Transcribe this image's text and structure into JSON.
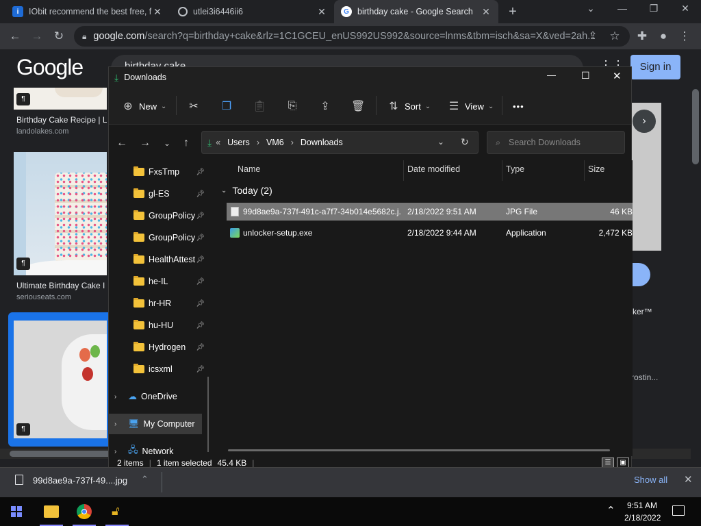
{
  "browser": {
    "tabs": [
      {
        "title": "IObit recommend the best free, f",
        "favicon_color": "#1e6bd6",
        "active": false
      },
      {
        "title": "utlei3i6446ii6",
        "favicon_color": "#5f6368",
        "active": false
      },
      {
        "title": "birthday cake - Google Search",
        "favicon_color": "#4285f4",
        "active": true
      }
    ],
    "new_tab": "+",
    "omnibox": {
      "host": "google.com",
      "path": "/search?q=birthday+cake&rlz=1C1GCEU_enUS992US992&source=lnms&tbm=isch&sa=X&ved=2ah..."
    }
  },
  "google": {
    "logo": "Google",
    "search_value": "birthday cake",
    "signin": "Sign in",
    "results": [
      {
        "caption": "Birthday Cake Recipe | L",
        "source": "landolakes.com"
      },
      {
        "caption": "Ultimate Birthday Cake I",
        "source": "seriouseats.com"
      },
      {
        "caption": "ker™",
        "source": ""
      },
      {
        "caption": "rostin...",
        "source": ""
      }
    ]
  },
  "explorer": {
    "title": "Downloads",
    "commands": {
      "new": "New",
      "sort": "Sort",
      "view": "View",
      "more": "•••"
    },
    "breadcrumb": {
      "overflow": "«",
      "parts": [
        "Users",
        "VM6",
        "Downloads"
      ],
      "sep": "›"
    },
    "search_placeholder": "Search Downloads",
    "nav_items": [
      {
        "label": "FxsTmp",
        "pinned": true
      },
      {
        "label": "gl-ES",
        "pinned": true
      },
      {
        "label": "GroupPolicy",
        "pinned": true
      },
      {
        "label": "GroupPolicy",
        "pinned": true
      },
      {
        "label": "HealthAttest",
        "pinned": true
      },
      {
        "label": "he-IL",
        "pinned": true
      },
      {
        "label": "hr-HR",
        "pinned": true
      },
      {
        "label": "hu-HU",
        "pinned": true
      },
      {
        "label": "Hydrogen",
        "pinned": true
      },
      {
        "label": "icsxml",
        "pinned": true
      }
    ],
    "nav_roots": [
      {
        "label": "OneDrive"
      },
      {
        "label": "My Computer"
      },
      {
        "label": "Network"
      }
    ],
    "columns": {
      "name": "Name",
      "date": "Date modified",
      "type": "Type",
      "size": "Size"
    },
    "group": "Today (2)",
    "files": [
      {
        "name": "99d8ae9a-737f-491c-a7f7-34b014e5682c.j...",
        "date": "2/18/2022 9:51 AM",
        "type": "JPG File",
        "size": "46 KB",
        "selected": true
      },
      {
        "name": "unlocker-setup.exe",
        "date": "2/18/2022 9:44 AM",
        "type": "Application",
        "size": "2,472 KB",
        "selected": false
      }
    ],
    "status": {
      "count": "2 items",
      "selected": "1 item selected",
      "size": "45.4 KB"
    }
  },
  "downloads_bar": {
    "file": "99d8ae9a-737f-49....jpg",
    "show_all": "Show all"
  },
  "taskbar": {
    "time": "9:51 AM",
    "date": "2/18/2022"
  }
}
